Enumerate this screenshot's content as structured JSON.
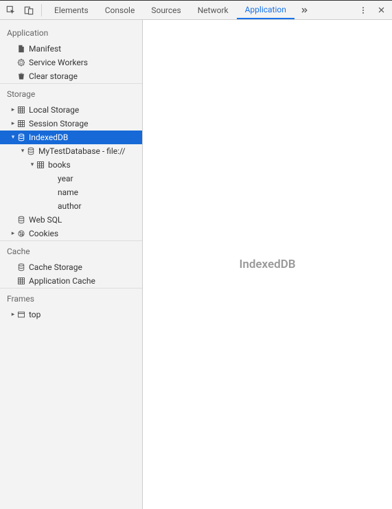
{
  "toolbar": {
    "tabs": [
      {
        "label": "Elements"
      },
      {
        "label": "Console"
      },
      {
        "label": "Sources"
      },
      {
        "label": "Network"
      },
      {
        "label": "Application"
      }
    ],
    "active_tab_index": 4
  },
  "content": {
    "heading": "IndexedDB"
  },
  "sidebar": {
    "sections": [
      {
        "title": "Application",
        "rows": [
          {
            "label": "Manifest",
            "indent": 1,
            "arrow": "none",
            "icon": "doc"
          },
          {
            "label": "Service Workers",
            "indent": 1,
            "arrow": "none",
            "icon": "gear"
          },
          {
            "label": "Clear storage",
            "indent": 1,
            "arrow": "none",
            "icon": "trash"
          }
        ]
      },
      {
        "title": "Storage",
        "rows": [
          {
            "label": "Local Storage",
            "indent": 1,
            "arrow": "right",
            "icon": "grid"
          },
          {
            "label": "Session Storage",
            "indent": 1,
            "arrow": "right",
            "icon": "grid"
          },
          {
            "label": "IndexedDB",
            "indent": 1,
            "arrow": "down",
            "icon": "db",
            "selected": true
          },
          {
            "label": "MyTestDatabase - file://",
            "indent": 2,
            "arrow": "down",
            "icon": "db"
          },
          {
            "label": "books",
            "indent": 3,
            "arrow": "down",
            "icon": "grid"
          },
          {
            "label": "year",
            "indent": 4,
            "arrow": "none",
            "icon": ""
          },
          {
            "label": "name",
            "indent": 4,
            "arrow": "none",
            "icon": ""
          },
          {
            "label": "author",
            "indent": 4,
            "arrow": "none",
            "icon": ""
          },
          {
            "label": "Web SQL",
            "indent": 1,
            "arrow": "none",
            "icon": "db"
          },
          {
            "label": "Cookies",
            "indent": 1,
            "arrow": "right",
            "icon": "cookie"
          }
        ]
      },
      {
        "title": "Cache",
        "rows": [
          {
            "label": "Cache Storage",
            "indent": 1,
            "arrow": "none",
            "icon": "db"
          },
          {
            "label": "Application Cache",
            "indent": 1,
            "arrow": "none",
            "icon": "grid"
          }
        ]
      },
      {
        "title": "Frames",
        "rows": [
          {
            "label": "top",
            "indent": 1,
            "arrow": "right",
            "icon": "frame"
          }
        ]
      }
    ]
  }
}
